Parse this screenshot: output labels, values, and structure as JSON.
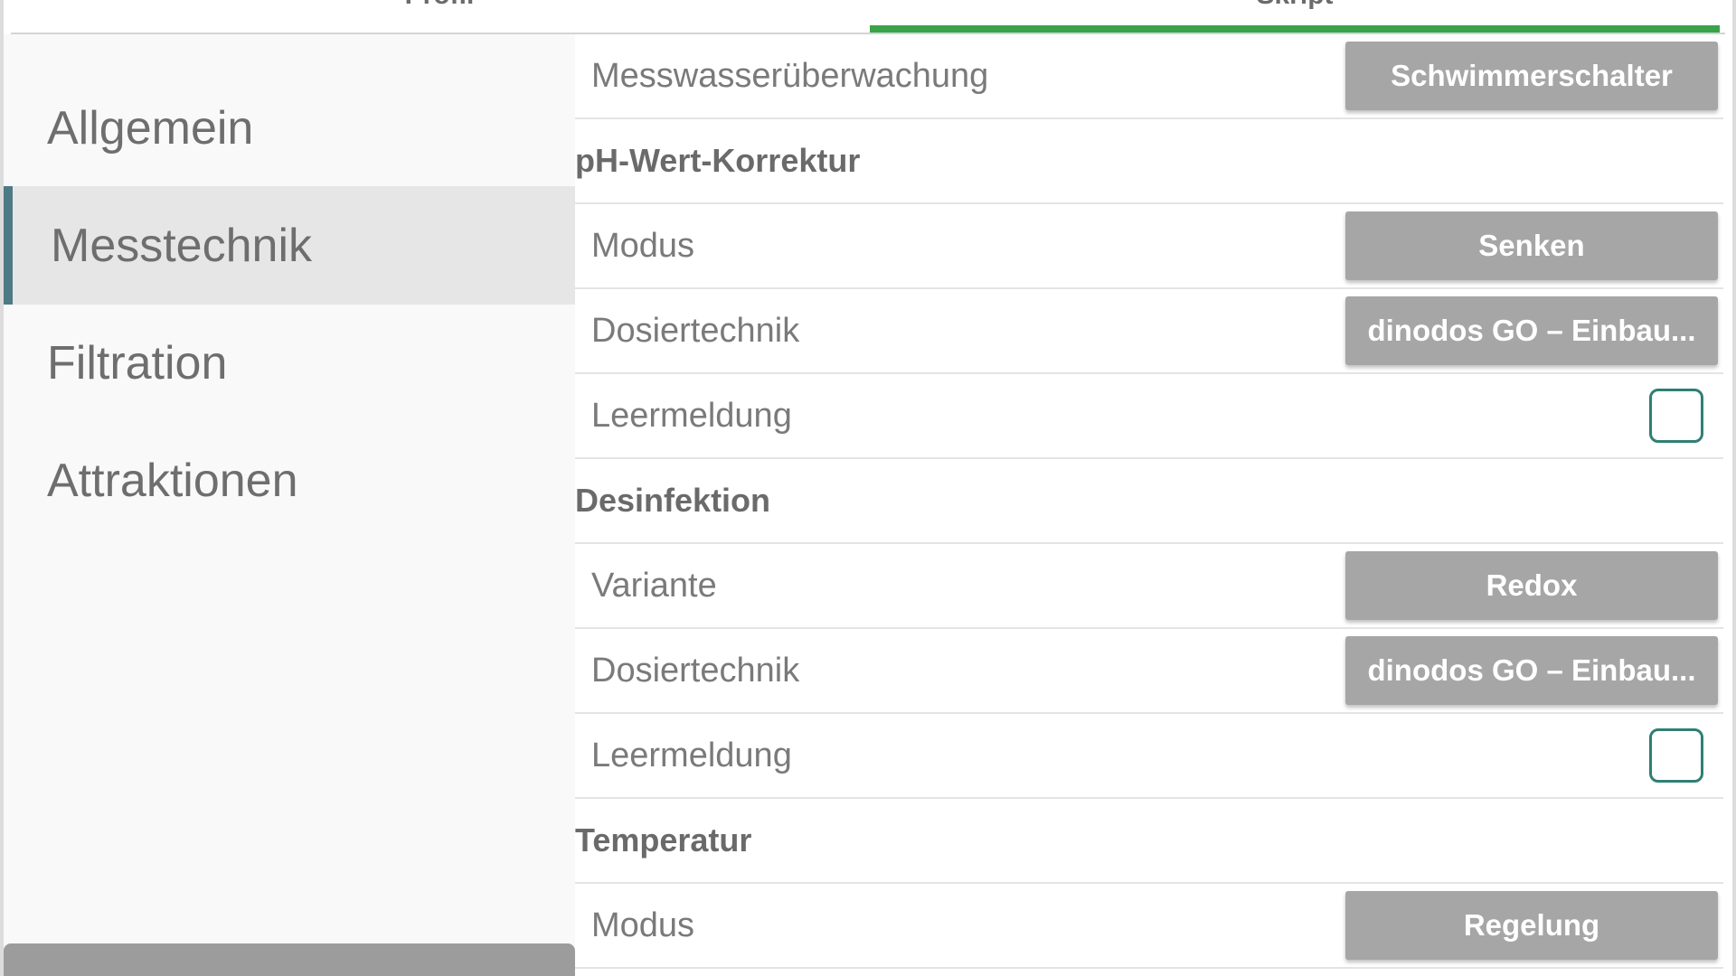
{
  "tabs": [
    {
      "label": "Profil"
    },
    {
      "label": "Skript"
    }
  ],
  "colors": {
    "accent_green": "#3aa34a",
    "sidebar_active_marker": "#4d7a85",
    "checkbox_border": "#2f7f74",
    "value_button_bg": "#a6a6a6"
  },
  "sidebar": {
    "items": [
      {
        "label": "Allgemein",
        "active": false
      },
      {
        "label": "Messtechnik",
        "active": true
      },
      {
        "label": "Filtration",
        "active": false
      },
      {
        "label": "Attraktionen",
        "active": false
      }
    ]
  },
  "content": {
    "rows": [
      {
        "kind": "setting",
        "label": "Messwasserüberwachung",
        "value": "Schwimmerschalter"
      },
      {
        "kind": "section",
        "label": "pH-Wert-Korrektur"
      },
      {
        "kind": "setting",
        "label": "Modus",
        "value": "Senken"
      },
      {
        "kind": "setting",
        "label": "Dosiertechnik",
        "value": "dinodos GO – Einbau..."
      },
      {
        "kind": "checkbox",
        "label": "Leermeldung",
        "checked": false
      },
      {
        "kind": "section",
        "label": "Desinfektion"
      },
      {
        "kind": "setting",
        "label": "Variante",
        "value": "Redox"
      },
      {
        "kind": "setting",
        "label": "Dosiertechnik",
        "value": "dinodos GO – Einbau..."
      },
      {
        "kind": "checkbox",
        "label": "Leermeldung",
        "checked": false
      },
      {
        "kind": "section",
        "label": "Temperatur"
      },
      {
        "kind": "setting",
        "label": "Modus",
        "value": "Regelung"
      }
    ]
  }
}
